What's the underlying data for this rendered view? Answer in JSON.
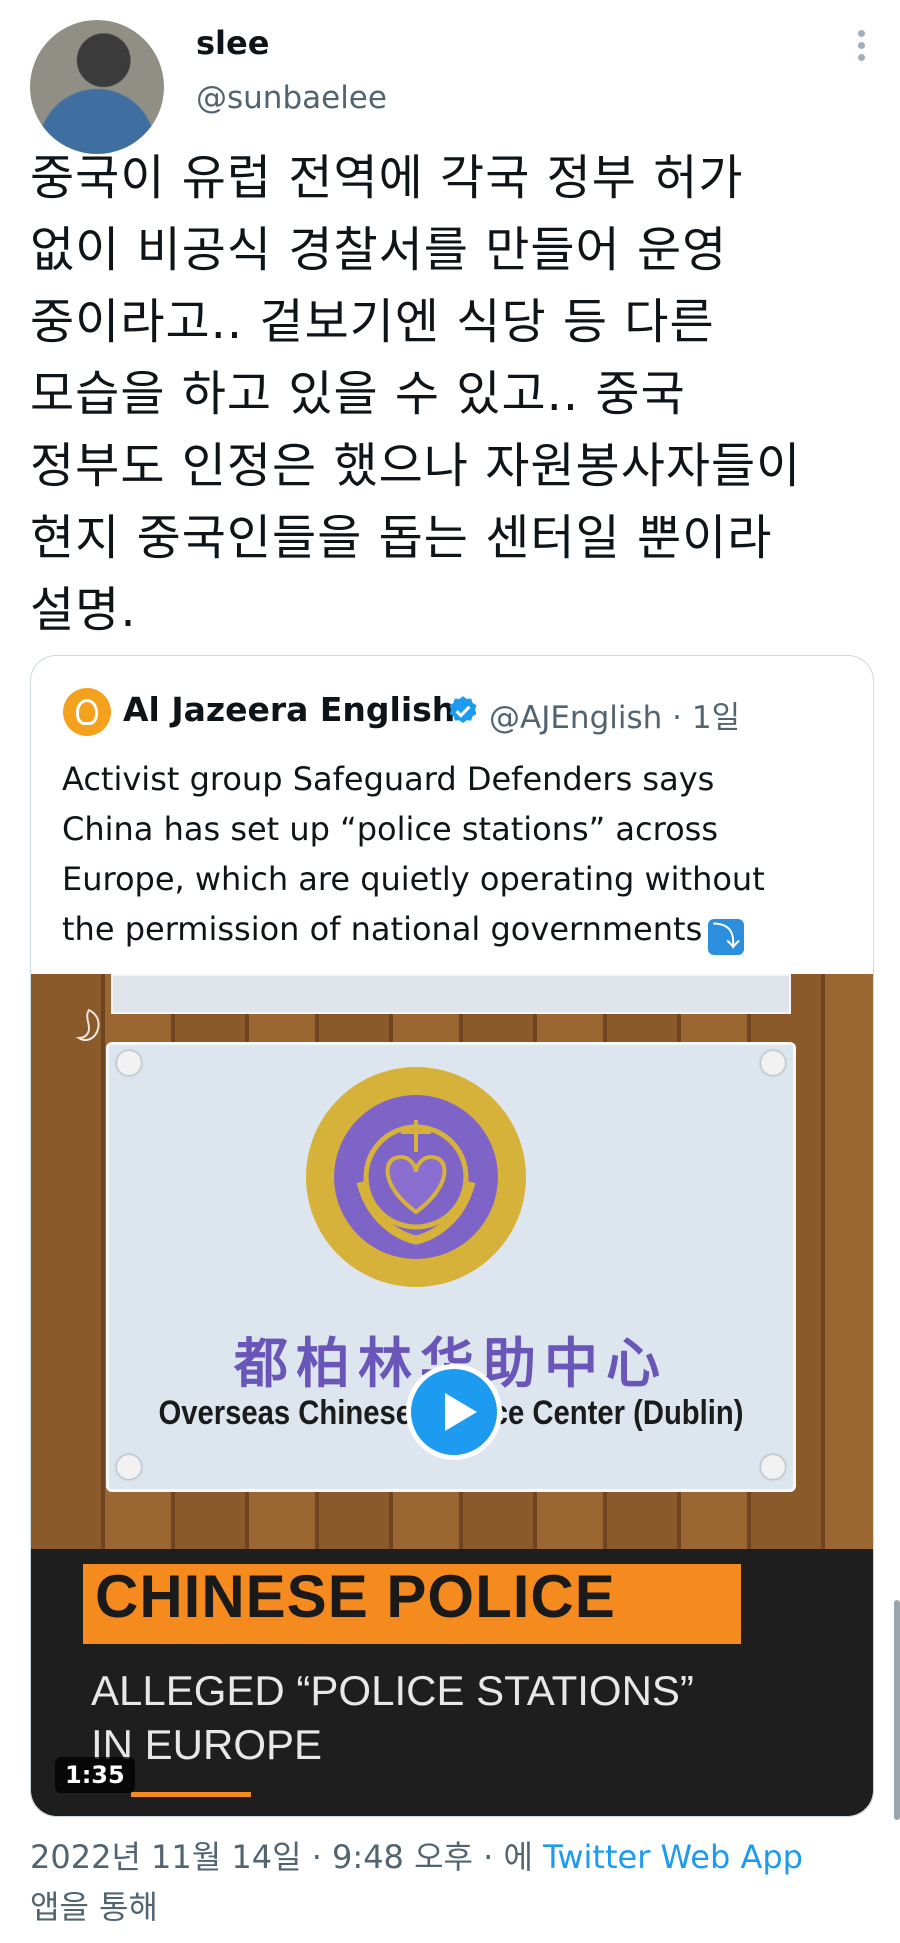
{
  "author": {
    "name": "slee",
    "handle": "@sunbaelee"
  },
  "tweet": {
    "text": "중국이 유럽 전역에 각국 정부 허가\n없이 비공식 경찰서를 만들어 운영\n중이라고.. 겉보기엔 식당 등 다른\n모습을 하고 있을 수 있고..  중국\n정부도 인정은 했으나 자원봉사자들이\n현지 중국인들을 돕는 센터일 뿐이라\n설명."
  },
  "quoted": {
    "name": "Al Jazeera English",
    "handle": "@AJEnglish · 1일",
    "text": "Activist group Safeguard Defenders says\nChina has set up “police stations” across\nEurope, which are quietly operating without\nthe permission of national governments",
    "emoji": "⤵",
    "media": {
      "sign_chinese": "都柏林华助中心",
      "sign_english": "Overseas Chinese Service Center (Dublin)",
      "seal_text": "OVERSEAS CHINESE SERVICE CENTER",
      "banner_title": "CHINESE POLICE",
      "banner_subtitle": "ALLEGED “POLICE STATIONS”\nIN EUROPE",
      "duration": "1:35"
    }
  },
  "meta": {
    "timestamp": "2022년 11월 14일 · 9:48 오후 · 에 ",
    "app": "Twitter Web App",
    "suffix": "앱을 통해"
  },
  "colors": {
    "accent": "#1d9bf0",
    "banner_orange": "#f58a1f",
    "sign_purple": "#6a55b8"
  },
  "icons": [
    "more-options-icon",
    "verified-badge-icon",
    "play-icon",
    "arrow-down-emoji-icon"
  ]
}
